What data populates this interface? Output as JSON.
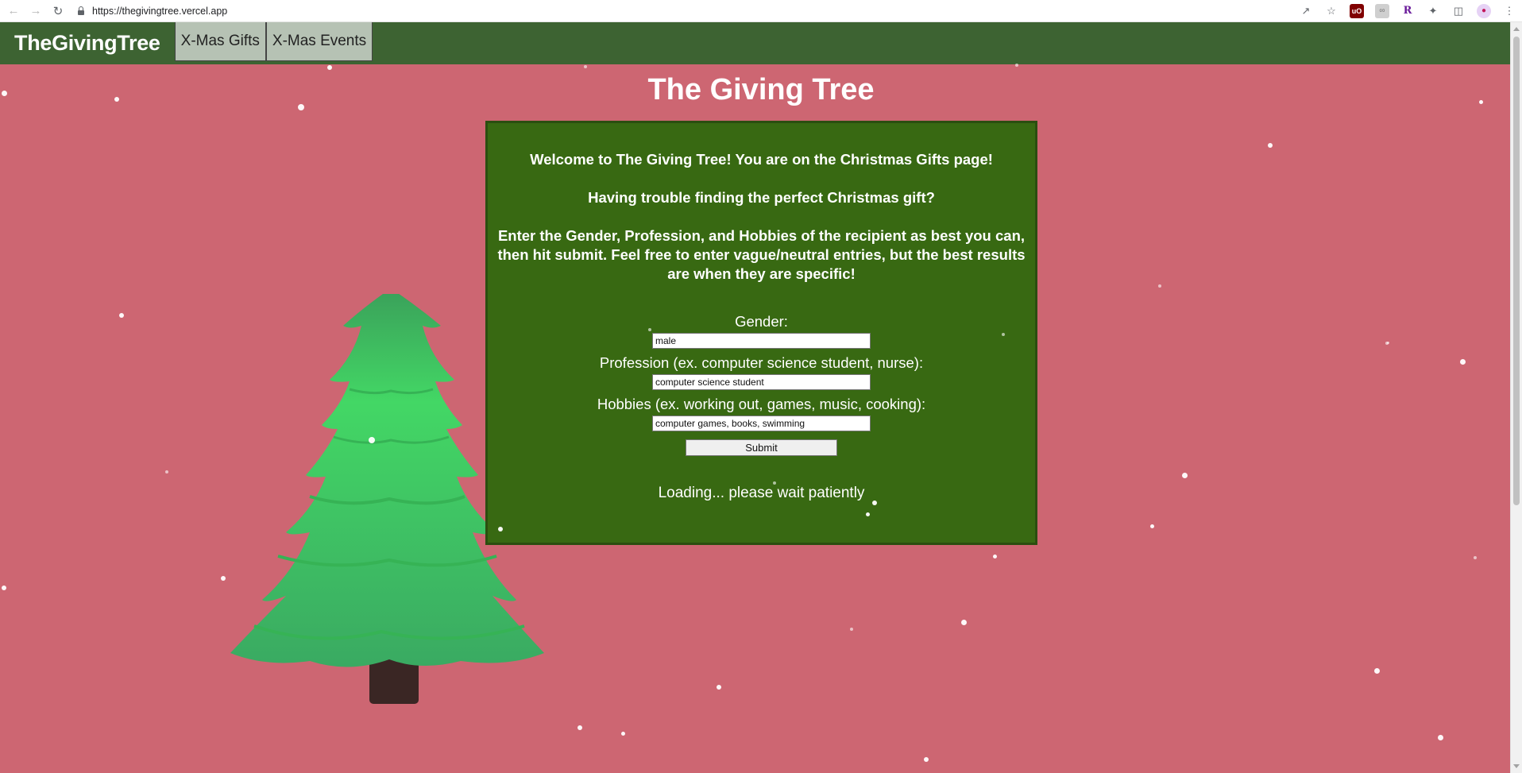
{
  "browser": {
    "url": "https://thegivingtree.vercel.app",
    "icons": [
      "back-arrow-icon",
      "forward-arrow-icon",
      "reload-icon",
      "lock-icon",
      "share-icon",
      "star-icon",
      "ublock-icon",
      "extension-grey-icon",
      "r-extension-icon",
      "puzzle-icon",
      "sidepanel-icon",
      "profile-avatar-icon",
      "kebab-menu-icon"
    ]
  },
  "nav": {
    "brand": "TheGivingTree",
    "tabs": [
      "X-Mas Gifts",
      "X-Mas Events"
    ]
  },
  "page": {
    "title": "The Giving Tree",
    "intro": [
      "Welcome to The Giving Tree! You are on the Christmas Gifts page!",
      "Having trouble finding the perfect Christmas gift?",
      "Enter the Gender, Profession, and Hobbies of the recipient as best you can, then hit submit. Feel free to enter vague/neutral entries, but the best results are when they are specific!"
    ],
    "form": {
      "gender_label": "Gender:",
      "gender_value": "male",
      "profession_label": "Profession (ex. computer science student, nurse):",
      "profession_value": "computer science student",
      "hobbies_label": "Hobbies (ex. working out, games, music, cooking):",
      "hobbies_value": "computer games, books, swimming",
      "submit_label": "Submit"
    },
    "status": "Loading... please wait patiently"
  },
  "colors": {
    "background": "#cd6672",
    "nav": "#3d6332",
    "panel": "#386912",
    "tab": "#b6c2b4",
    "tree": "#3ecf5c",
    "trunk": "#3a2624"
  }
}
